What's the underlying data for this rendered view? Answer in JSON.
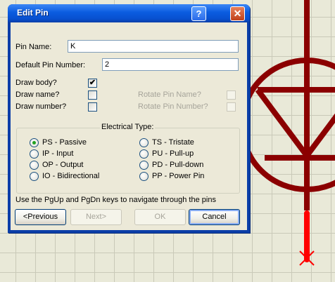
{
  "dialog": {
    "title": "Edit Pin",
    "help_button": "?",
    "close_button": "✕"
  },
  "fields": {
    "pin_name_label": "Pin Name:",
    "pin_name_value": "K",
    "default_pin_number_label": "Default Pin Number:",
    "default_pin_number_value": "2"
  },
  "checkboxes": {
    "draw_body": {
      "label": "Draw body?",
      "checked": true
    },
    "draw_name": {
      "label": "Draw name?",
      "checked": false
    },
    "draw_number": {
      "label": "Draw number?",
      "checked": false
    },
    "rotate_pin_name": {
      "label": "Rotate Pin Name?",
      "checked": false,
      "enabled": false
    },
    "rotate_pin_number": {
      "label": "Rotate Pin Number?",
      "checked": false,
      "enabled": false
    }
  },
  "electrical_type": {
    "title": "Electrical Type:",
    "selected": "PS - Passive",
    "options": [
      "PS - Passive",
      "IP - Input",
      "OP - Output",
      "IO - Bidirectional",
      "TS - Tristate",
      "PU - Pull-up",
      "PD - Pull-down",
      "PP - Power Pin"
    ]
  },
  "hint": "Use the PgUp and PgDn keys to navigate through the pins",
  "buttons": {
    "previous": "<Previous",
    "next": "Next>",
    "ok": "OK",
    "cancel": "Cancel"
  },
  "colors": {
    "schematic_symbol": "#8b0000",
    "selected_pin": "#ff0000",
    "grid": "#c9c9b8",
    "title_bar": "#0a5ce0"
  }
}
